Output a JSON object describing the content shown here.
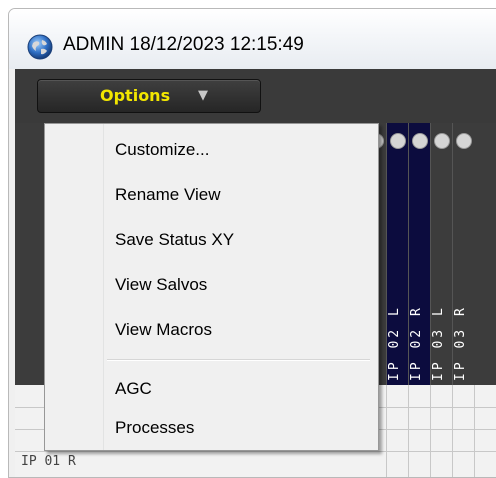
{
  "window": {
    "title": "ADMIN 18/12/2023 12:15:49"
  },
  "toolbar": {
    "options_label": "Options",
    "options_caret": "▼"
  },
  "menu": {
    "items": [
      {
        "label": "Customize..."
      },
      {
        "label": "Rename View"
      },
      {
        "label": "Save Status XY"
      },
      {
        "label": "View Salvos"
      },
      {
        "label": "View Macros"
      },
      {
        "label": "AGC"
      },
      {
        "label": "Processes"
      }
    ]
  },
  "grid": {
    "columns": [
      {
        "label": "IP 02 L"
      },
      {
        "label": "IP 02 R"
      },
      {
        "label": "IP 03 L"
      },
      {
        "label": "IP 03 R"
      }
    ],
    "row_label": "IP 01 R"
  },
  "colors": {
    "options_text": "#f2e600",
    "column_dark": "#0c0c3e",
    "toolbar_bg": "#3a3a3a"
  }
}
